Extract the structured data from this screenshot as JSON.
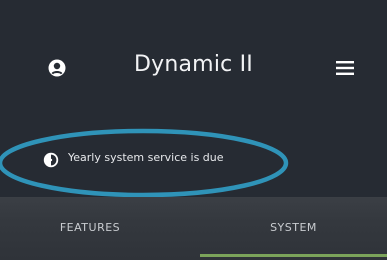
{
  "header": {
    "title": "Dynamic II",
    "user_icon": "user-circle-icon",
    "menu_icon": "hamburger-menu-icon"
  },
  "notice": {
    "icon": "service-clock-icon",
    "text": "Yearly system service is due"
  },
  "tabs": [
    {
      "label": "FEATURES",
      "selected": false
    },
    {
      "label": "SYSTEM",
      "selected": true
    }
  ],
  "colors": {
    "background": "#262b33",
    "tab_bar": "#353940",
    "accent": "#7ba35a",
    "highlight_ring": "#2f93b8"
  }
}
